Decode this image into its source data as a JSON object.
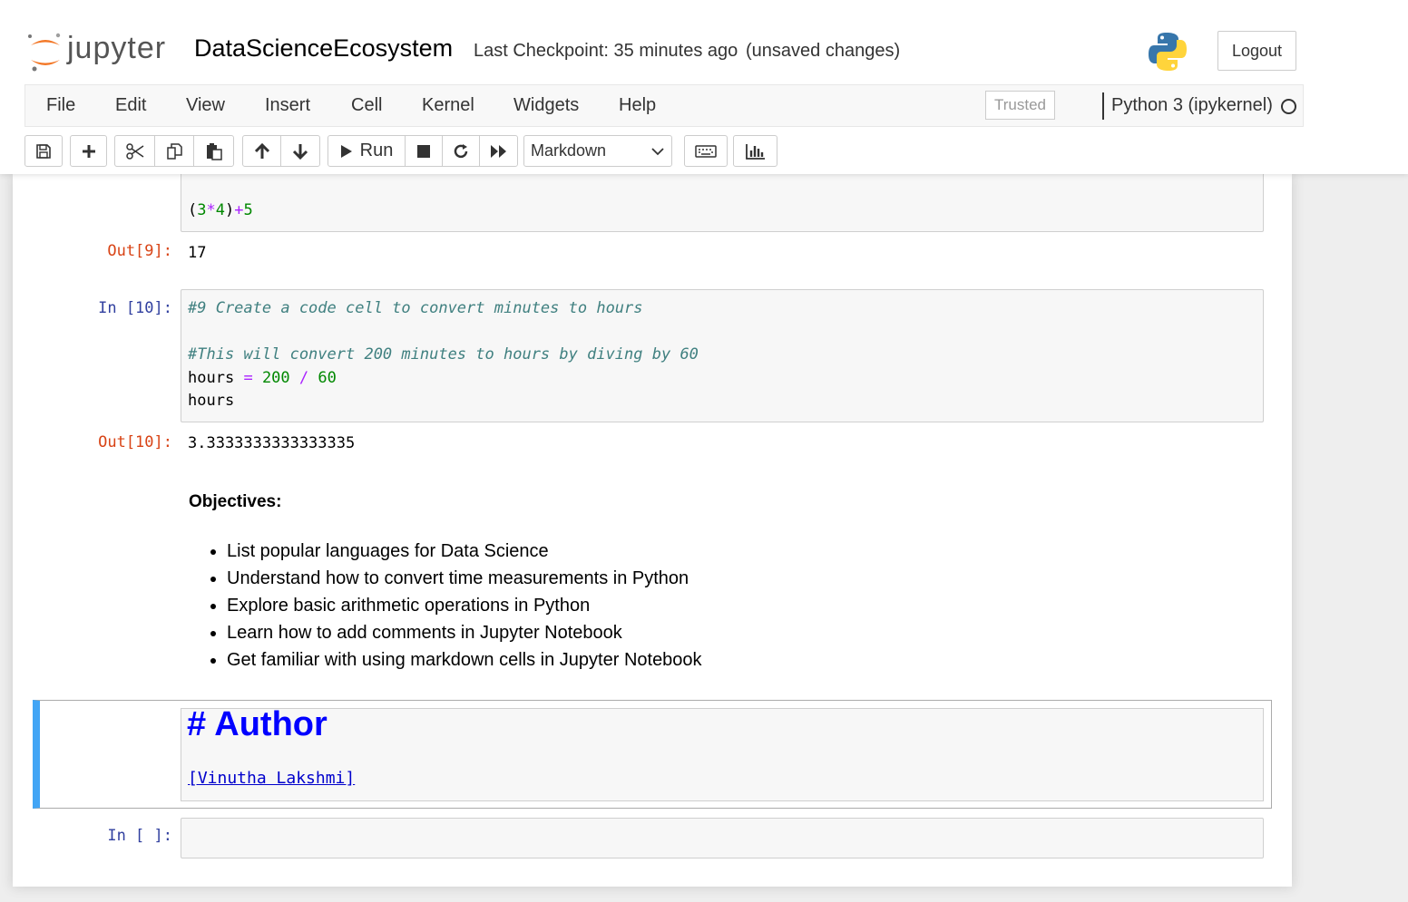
{
  "header": {
    "logo_text": "jupyter",
    "notebook_name": "DataScienceEcosystem",
    "checkpoint": "Last Checkpoint: 35 minutes ago",
    "unsaved": "(unsaved changes)",
    "logout_label": "Logout"
  },
  "menubar": {
    "items": [
      "File",
      "Edit",
      "View",
      "Insert",
      "Cell",
      "Kernel",
      "Widgets",
      "Help"
    ],
    "trusted": "Trusted",
    "kernel": "Python 3 (ipykernel)"
  },
  "toolbar": {
    "run_label": "Run",
    "cell_type": "Markdown",
    "icons": [
      "save-icon",
      "plus-icon",
      "cut-icon",
      "copy-icon",
      "paste-icon",
      "arrow-up-icon",
      "arrow-down-icon",
      "run-icon",
      "stop-icon",
      "restart-icon",
      "fast-forward-icon",
      "keyboard-icon",
      "bar-chart-icon"
    ]
  },
  "cells": {
    "cell9": {
      "code_text": "(3*4)+5",
      "code_tokens": [
        "(",
        "3",
        "*",
        "4",
        ")",
        "+",
        "5"
      ],
      "out_prompt": "Out[9]:",
      "output": "17"
    },
    "cell10": {
      "in_prompt": "In [10]:",
      "line1": "#9 Create a code cell to convert minutes to hours",
      "line2": "#This will convert 200 minutes to hours by diving by 60",
      "line3_var": "hours",
      "line3_eq": "=",
      "line3_a": "200",
      "line3_div": "/",
      "line3_b": "60",
      "line4": "hours",
      "out_prompt": "Out[10]:",
      "output": "3.3333333333333335"
    },
    "markdown": {
      "heading": "Objectives:",
      "items": [
        "List popular languages for Data Science",
        "Understand how to convert time measurements in Python",
        "Explore basic arithmetic operations in Python",
        "Learn how to add comments in Jupyter Notebook",
        "Get familiar with using markdown cells in Jupyter Notebook"
      ]
    },
    "author": {
      "heading": "# Author",
      "link": "[Vinutha Lakshmi]"
    },
    "empty": {
      "in_prompt": "In [ ]:"
    }
  },
  "colors": {
    "in_prompt": "#303f9f",
    "out_prompt": "#d84315",
    "comment": "#408080",
    "number": "#008800",
    "operator": "#aa22ff",
    "selected_bar": "#42a5f5",
    "author_heading": "#0000ff"
  }
}
